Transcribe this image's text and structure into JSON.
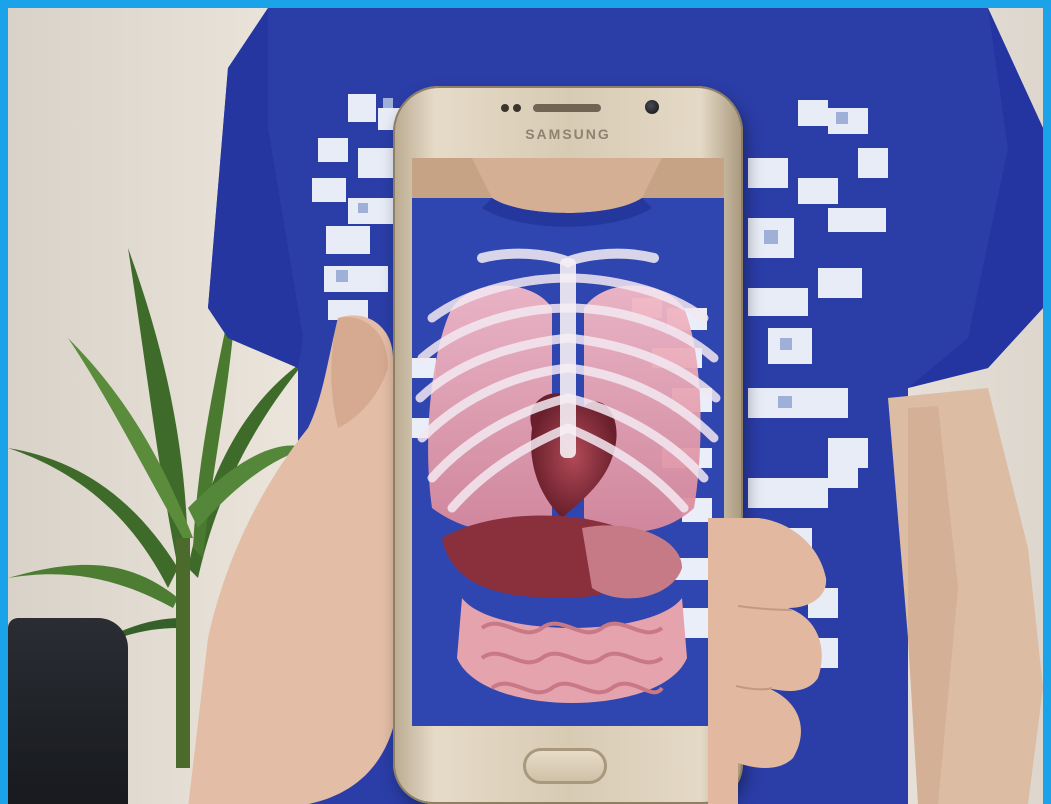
{
  "phone": {
    "brand_label": "SAMSUNG"
  },
  "colors": {
    "border": "#1aa3e8",
    "shirt": "#2b3ea8",
    "phone_body": "#d8cbb4"
  }
}
